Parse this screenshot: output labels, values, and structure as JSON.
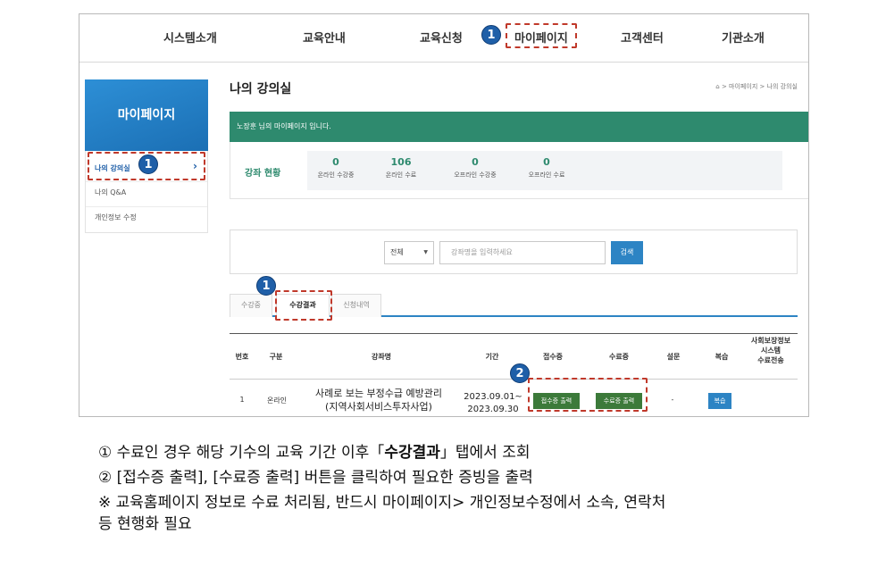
{
  "nav": {
    "items": [
      "시스템소개",
      "교육안내",
      "교육신청",
      "마이페이지",
      "고객센터",
      "기관소개"
    ]
  },
  "badges": {
    "one": "1",
    "two": "2"
  },
  "sidebar": {
    "title": "마이페이지",
    "items": [
      {
        "label": "나의 강의실",
        "chevron": "›"
      },
      {
        "label": "나의 Q&A"
      },
      {
        "label": "개인정보 수정"
      }
    ]
  },
  "main": {
    "title": "나의 강의실",
    "breadcrumb": "⌂ > 마이페이지 > 나의 강의실",
    "greeting": "노장훈 님의 마이페이지 입니다.",
    "stats_label": "강좌 현황",
    "stats": [
      {
        "value": "0",
        "label": "온라인 수강중"
      },
      {
        "value": "106",
        "label": "온라인 수료"
      },
      {
        "value": "0",
        "label": "오프라인 수강중"
      },
      {
        "value": "0",
        "label": "오프라인 수료"
      }
    ]
  },
  "search": {
    "select_value": "전체",
    "placeholder": "강좌명을 입력하세요",
    "button": "검색"
  },
  "tabs": [
    "수강중",
    "수강결과",
    "신청내역"
  ],
  "table": {
    "headers": [
      "번호",
      "구분",
      "강좌명",
      "기간",
      "접수증",
      "수료증",
      "설문",
      "복습",
      "사회보장정보\n시스템\n수료전송"
    ],
    "row": {
      "no": "1",
      "type": "온라인",
      "course_line1": "사례로 보는 부정수급 예방관리",
      "course_line2": "(지역사회서비스투자사업)",
      "period_line1": "2023.09.01~",
      "period_line2": "2023.09.30",
      "receipt_btn": "접수증 출력",
      "cert_btn": "수료증 출력",
      "survey": "-",
      "review_btn": "복습"
    }
  },
  "notes": {
    "n1_pre": "① 수료인 경우 해당 기수의 교육 기간 이후「",
    "n1_bold": "수강결과",
    "n1_post": "」탭에서 조회",
    "n2": "② [접수증 출력], [수료증 출력] 버튼을 클릭하여 필요한 증빙을 출력",
    "n3_line1": "※ 교육홈페이지 정보로 수료 처리됨, 반드시 마이페이지> 개인정보수정에서 소속, 연락처",
    "n3_line2": "등 현행화 필요"
  }
}
